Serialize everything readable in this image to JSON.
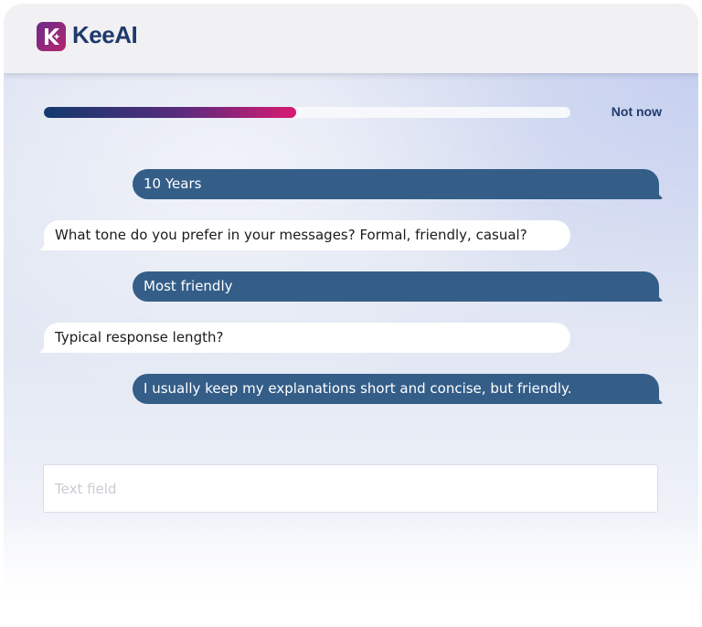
{
  "brand": {
    "name": "KeeAI",
    "logo_icon": "keeai-logo-icon"
  },
  "progress": {
    "percent": 48
  },
  "actions": {
    "not_now_label": "Not now"
  },
  "messages": [
    {
      "role": "user",
      "text": "10 Years"
    },
    {
      "role": "assistant",
      "text": "What tone do you prefer in your messages? Formal, friendly, casual?"
    },
    {
      "role": "user",
      "text": "Most friendly"
    },
    {
      "role": "assistant",
      "text": "Typical response length?"
    },
    {
      "role": "user",
      "text": "I usually keep my explanations short and concise, but friendly."
    }
  ],
  "input": {
    "placeholder": "Text field",
    "value": ""
  },
  "colors": {
    "accent": "#1f3a6b",
    "user_bubble": "#345e88",
    "bot_bubble": "#ffffff",
    "progress_start": "#123a6e",
    "progress_end": "#d81b72"
  }
}
